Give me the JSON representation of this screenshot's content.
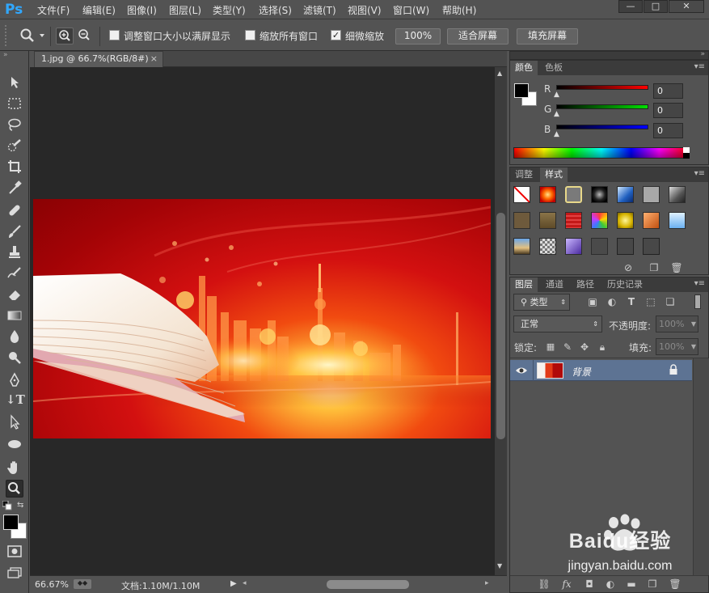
{
  "app": {
    "logo": "Ps"
  },
  "menu": [
    "文件(F)",
    "编辑(E)",
    "图像(I)",
    "图层(L)",
    "类型(Y)",
    "选择(S)",
    "滤镜(T)",
    "视图(V)",
    "窗口(W)",
    "帮助(H)"
  ],
  "window_controls": {
    "minimize": "—",
    "restore": "□",
    "close": "✕"
  },
  "options": {
    "resize_windows": {
      "label": "调整窗口大小以满屏显示",
      "checked": false
    },
    "zoom_all": {
      "label": "缩放所有窗口",
      "checked": false
    },
    "scrubby_zoom": {
      "label": "细微缩放",
      "checked": true
    },
    "zoom_value": "100%",
    "fit_screen": "适合屏幕",
    "fill_screen": "填充屏幕"
  },
  "document": {
    "tab_title": "1.jpg @ 66.7%(RGB/8#)",
    "tab_close": "×",
    "zoom": "66.67%",
    "doc_info": "文档:1.10M/1.10M"
  },
  "color_panel": {
    "tabs": [
      "颜色",
      "色板"
    ],
    "channels": [
      {
        "label": "R",
        "value": "0"
      },
      {
        "label": "G",
        "value": "0"
      },
      {
        "label": "B",
        "value": "0"
      }
    ]
  },
  "styles_panel": {
    "tabs": [
      "调整",
      "样式"
    ]
  },
  "layers_panel": {
    "tabs": [
      "图层",
      "通道",
      "路径",
      "历史记录"
    ],
    "filter_kind": "类型",
    "blend_mode": "正常",
    "opacity_label": "不透明度:",
    "opacity_value": "100%",
    "lock_label": "锁定:",
    "fill_label": "填充:",
    "fill_value": "100%",
    "layer_name": "背景"
  },
  "colors": {
    "accent": "#31a8ff",
    "selected_layer": "#5d7393",
    "canvas": "#282828"
  },
  "watermark": {
    "brand": "Baidu经验",
    "url": "jingyan.baidu.com"
  }
}
